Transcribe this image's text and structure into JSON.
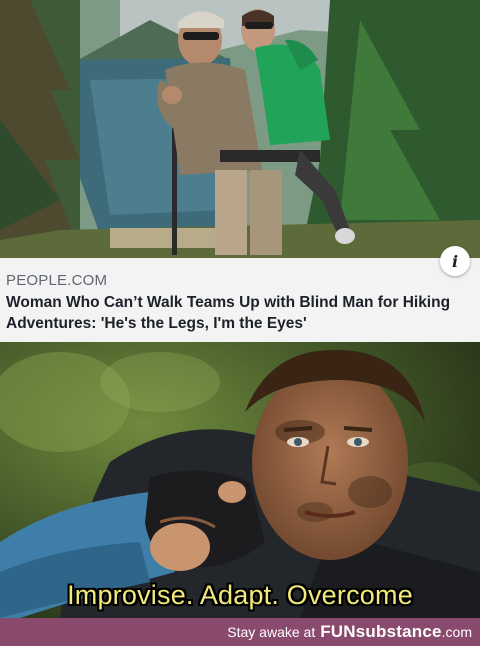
{
  "article_card": {
    "source": "PEOPLE.COM",
    "headline": "Woman Who Can’t Walk Teams Up with Blind Man for Hiking Adventures: 'He's the Legs, I'm the Eyes'",
    "info_icon": "info-icon",
    "info_glyph": "i"
  },
  "meme": {
    "caption": "Improvise. Adapt. Overcome"
  },
  "footer": {
    "tagline": "Stay awake at",
    "brand": "FUNsubstance",
    "domain": ".com",
    "background_color": "#8a4a6d"
  }
}
